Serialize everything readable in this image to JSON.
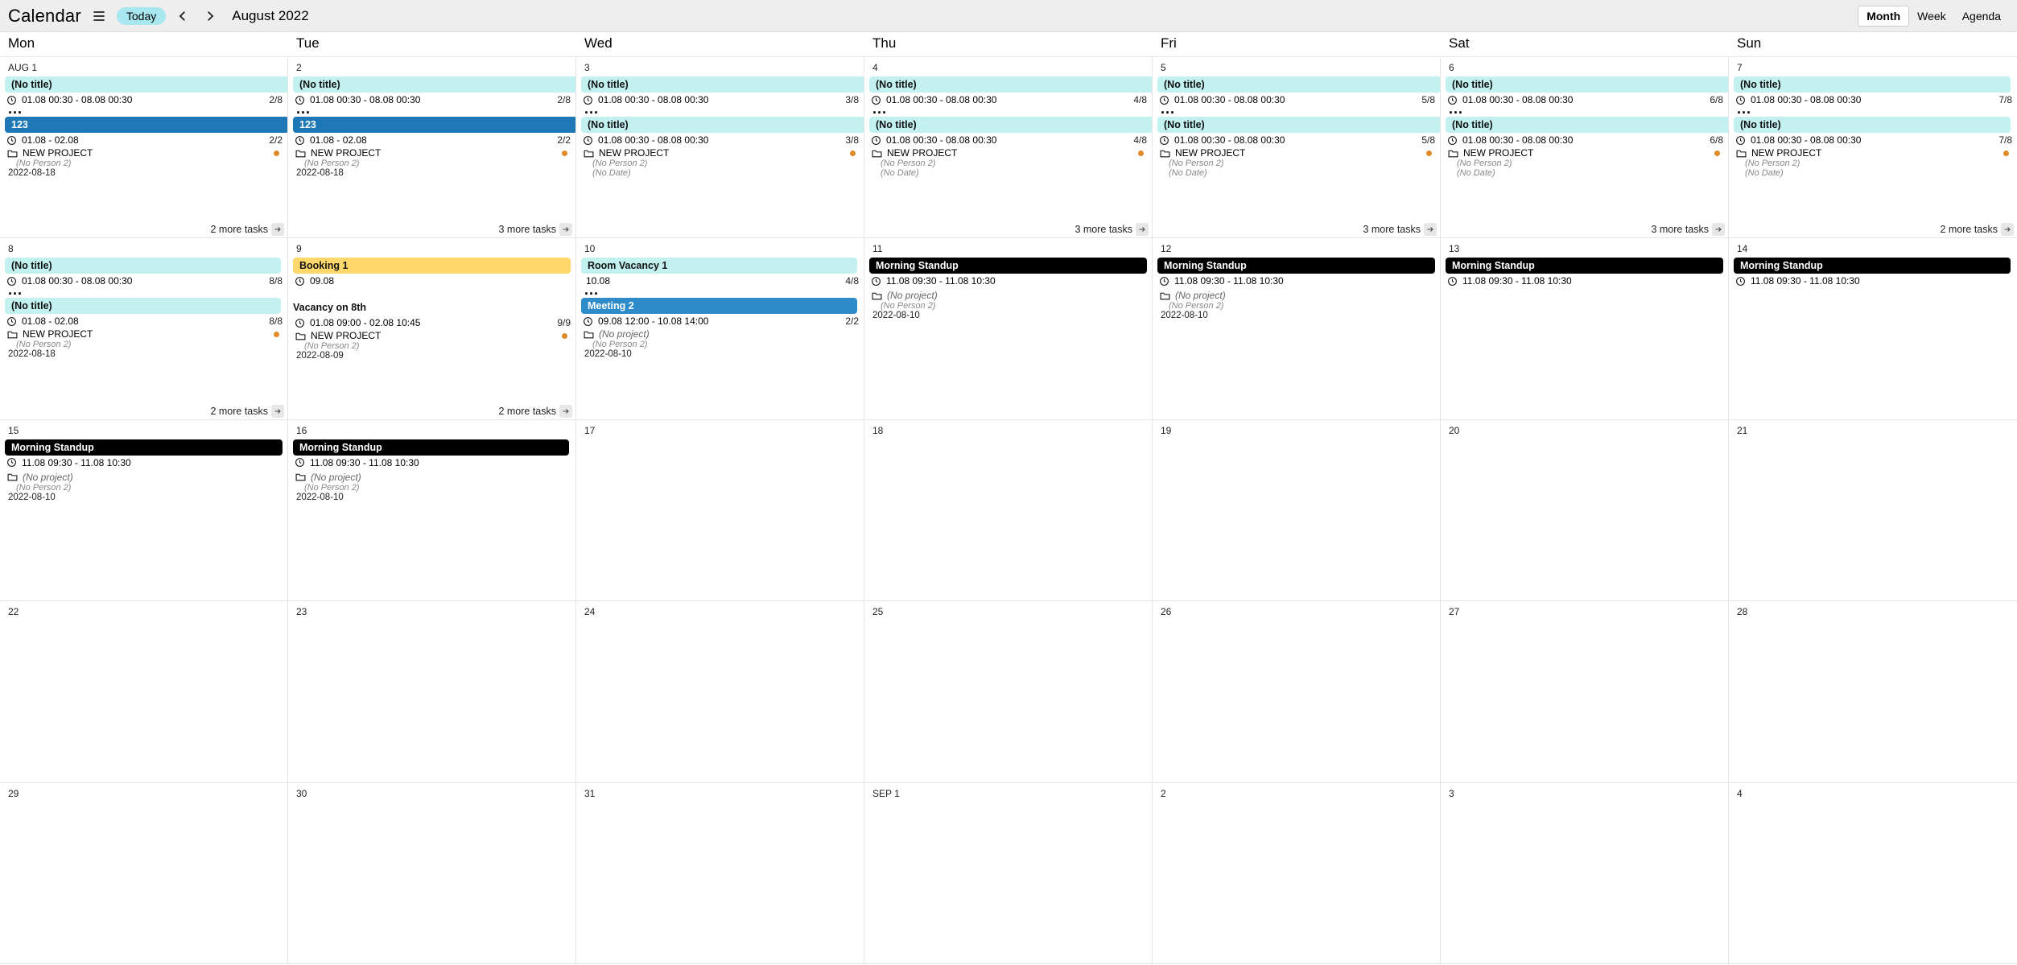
{
  "header": {
    "title": "Calendar",
    "today": "Today",
    "month_label": "August 2022",
    "views": {
      "month": "Month",
      "week": "Week",
      "agenda": "Agenda"
    }
  },
  "weekdays": [
    "Mon",
    "Tue",
    "Wed",
    "Thu",
    "Fri",
    "Sat",
    "Sun"
  ],
  "labels": {
    "no_title": "(No title)",
    "no_project_italic": "(No project)",
    "no_person": "(No Person 2)",
    "no_date": "(No Date)",
    "new_project": "NEW PROJECT",
    "morning_standup": "Morning Standup",
    "one_two_three": "123",
    "booking1": "Booking 1",
    "vacancy8": "Vacancy on 8th",
    "roomvac1": "Room Vacancy 1",
    "meeting2": "Meeting 2"
  },
  "times": {
    "span_0108_0808": "01.08 00:30 - 08.08 00:30",
    "span_0108_0208": "01.08 - 02.08",
    "span_0908_0208": "01.08 09:00 - 02.08 10:45",
    "span_0908_1200_1008_1400": "09.08 12:00 - 10.08 14:00",
    "span_1108_0930_1030": "11.08 09:30 - 11.08 10:30",
    "d_0908": "09.08",
    "d_1008": "10.08"
  },
  "dates": {
    "d_2022_08_18": "2022-08-18",
    "d_2022_08_09": "2022-08-09",
    "d_2022_08_10": "2022-08-10"
  },
  "counts": {
    "c28": "2/8",
    "c38": "3/8",
    "c48": "4/8",
    "c58": "5/8",
    "c68": "6/8",
    "c78": "7/8",
    "c88": "8/8",
    "c22_a": "2/2",
    "c99": "9/9",
    "c22_b": "2/2"
  },
  "more": {
    "two": "2 more tasks",
    "three": "3 more tasks"
  },
  "days": [
    "AUG 1",
    "2",
    "3",
    "4",
    "5",
    "6",
    "7",
    "8",
    "9",
    "10",
    "11",
    "12",
    "13",
    "14",
    "15",
    "16",
    "17",
    "18",
    "19",
    "20",
    "21",
    "22",
    "23",
    "24",
    "25",
    "26",
    "27",
    "28",
    "29",
    "30",
    "31",
    "SEP 1",
    "2",
    "3",
    "4"
  ]
}
